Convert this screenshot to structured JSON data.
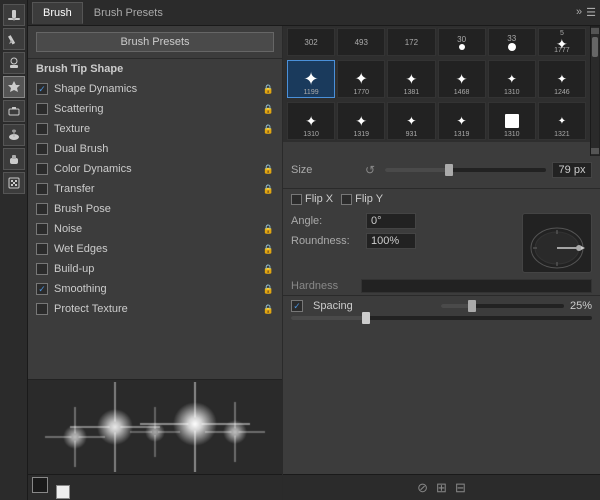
{
  "tabs": {
    "brush_label": "Brush",
    "brush_presets_label": "Brush Presets"
  },
  "toolbar": {
    "expand_icon": "»",
    "menu_icon": "☰"
  },
  "panel": {
    "brush_presets_button": "Brush Presets",
    "tip_shape_header": "Brush Tip Shape",
    "options": [
      {
        "label": "Shape Dynamics",
        "checked": true,
        "has_lock": true
      },
      {
        "label": "Scattering",
        "checked": false,
        "has_lock": true
      },
      {
        "label": "Texture",
        "checked": false,
        "has_lock": true
      },
      {
        "label": "Dual Brush",
        "checked": false,
        "has_lock": false
      },
      {
        "label": "Color Dynamics",
        "checked": false,
        "has_lock": true
      },
      {
        "label": "Transfer",
        "checked": false,
        "has_lock": true
      },
      {
        "label": "Brush Pose",
        "checked": false,
        "has_lock": false
      },
      {
        "label": "Noise",
        "checked": false,
        "has_lock": true
      },
      {
        "label": "Wet Edges",
        "checked": false,
        "has_lock": true
      },
      {
        "label": "Build-up",
        "checked": false,
        "has_lock": true
      },
      {
        "label": "Smoothing",
        "checked": true,
        "has_lock": true
      },
      {
        "label": "Protect Texture",
        "checked": false,
        "has_lock": true
      }
    ]
  },
  "brush_grid": {
    "row1_sizes": [
      "302",
      "493",
      "172",
      "30",
      "33",
      "1777"
    ],
    "row1_top": [
      "5",
      "",
      "",
      "",
      "",
      ""
    ],
    "row2_sizes": [
      "1199",
      "1770",
      "1381",
      "1468",
      "1310",
      "1246"
    ],
    "row3_sizes": [
      "1310",
      "1319",
      "931",
      "1319",
      "1310",
      "1321"
    ]
  },
  "controls": {
    "size_label": "Size",
    "size_value": "79 px",
    "size_percent": 40,
    "flip_x_label": "Flip X",
    "flip_y_label": "Flip Y",
    "angle_label": "Angle:",
    "angle_value": "0°",
    "roundness_label": "Roundness:",
    "roundness_value": "100%",
    "hardness_label": "Hardness",
    "spacing_label": "Spacing",
    "spacing_value": "25%",
    "spacing_checked": true
  },
  "colors": {
    "foreground": "#1a1a1a",
    "background": "#eeeeee"
  },
  "bottom_toolbar": {
    "icon1": "⊘",
    "icon2": "⊞",
    "icon3": "⊟"
  }
}
